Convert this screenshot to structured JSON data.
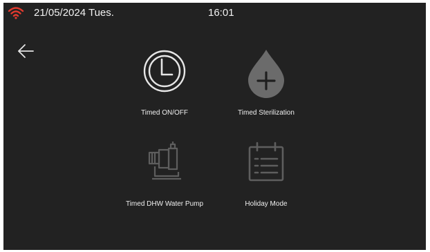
{
  "status_bar": {
    "date": "21/05/2024 Tues.",
    "time": "16:01",
    "wifi_icon": "wifi-icon",
    "wifi_color": "#e23a2e"
  },
  "nav": {
    "back_icon": "back-arrow-icon"
  },
  "menu": {
    "items": [
      {
        "label": "Timed ON/OFF",
        "icon": "clock-icon",
        "state": "enabled"
      },
      {
        "label": "Timed Sterilization",
        "icon": "water-drop-plus-icon",
        "state": "enabled"
      },
      {
        "label": "Timed DHW Water Pump",
        "icon": "water-pump-icon",
        "state": "disabled"
      },
      {
        "label": "Holiday Mode",
        "icon": "calendar-list-icon",
        "state": "disabled"
      }
    ]
  },
  "colors": {
    "background": "#222222",
    "icon_active": "#e6e6e6",
    "icon_drop": "#6b6b6b",
    "icon_disabled": "#5e5e5e"
  }
}
